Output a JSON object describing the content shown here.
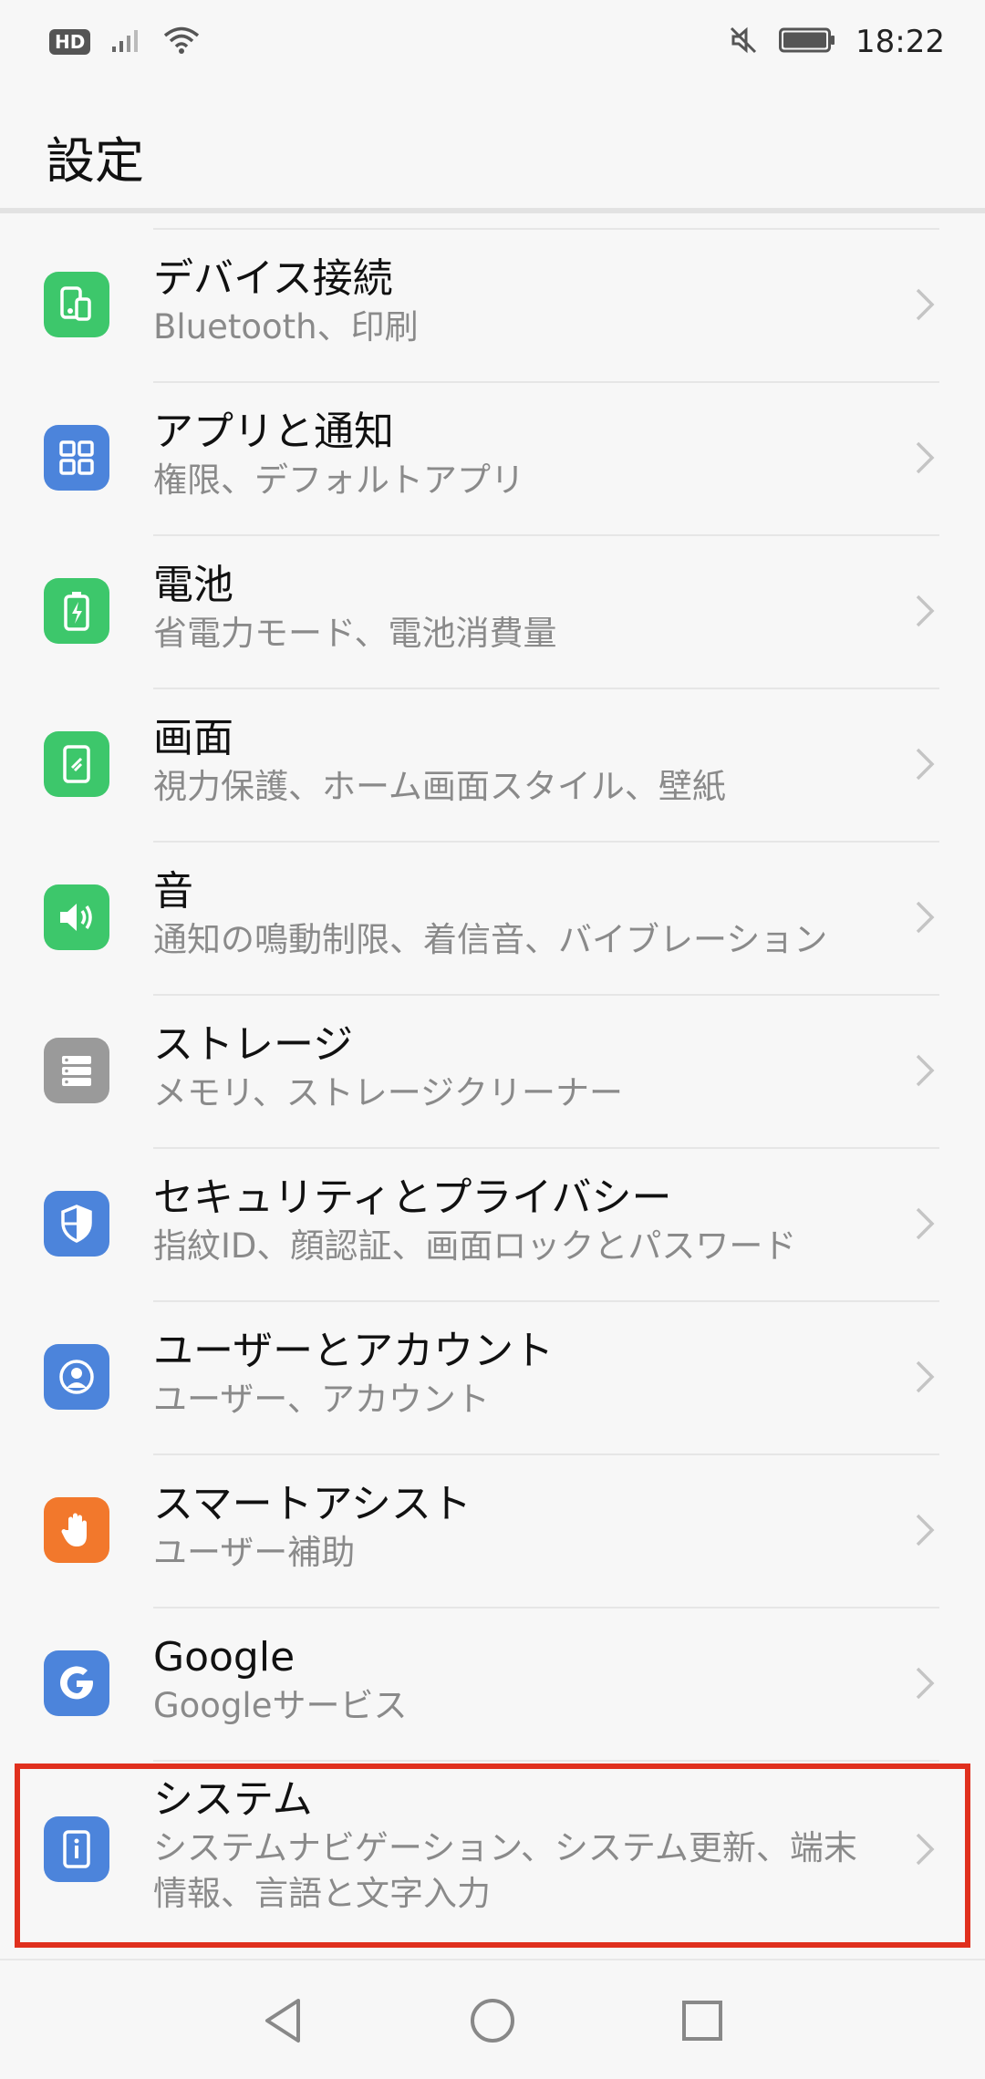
{
  "status_bar": {
    "hd_label": "HD",
    "time": "18:22",
    "icons": [
      "signal-icon",
      "wifi-icon",
      "mute-icon",
      "battery-icon"
    ]
  },
  "header": {
    "title": "設定"
  },
  "items": [
    {
      "title": "デバイス接続",
      "subtitle": "Bluetooth、印刷",
      "icon": "device-connection-icon",
      "color": "#3dc76b"
    },
    {
      "title": "アプリと通知",
      "subtitle": "権限、デフォルトアプリ",
      "icon": "apps-grid-icon",
      "color": "#4c84db"
    },
    {
      "title": "電池",
      "subtitle": "省電力モード、電池消費量",
      "icon": "battery-icon",
      "color": "#3dc76b"
    },
    {
      "title": "画面",
      "subtitle": "視力保護、ホーム画面スタイル、壁紙",
      "icon": "display-icon",
      "color": "#3dc76b"
    },
    {
      "title": "音",
      "subtitle": "通知の鳴動制限、着信音、バイブレーション",
      "icon": "speaker-icon",
      "color": "#3dc76b"
    },
    {
      "title": "ストレージ",
      "subtitle": "メモリ、ストレージクリーナー",
      "icon": "storage-icon",
      "color": "#9a9a9a"
    },
    {
      "title": "セキュリティとプライバシー",
      "subtitle": "指紋ID、顔認証、画面ロックとパスワード",
      "icon": "shield-icon",
      "color": "#4c84db"
    },
    {
      "title": "ユーザーとアカウント",
      "subtitle": "ユーザー、アカウント",
      "icon": "user-icon",
      "color": "#4c84db"
    },
    {
      "title": "スマートアシスト",
      "subtitle": "ユーザー補助",
      "icon": "hand-icon",
      "color": "#f2782c"
    },
    {
      "title": "Google",
      "subtitle": "Googleサービス",
      "icon": "google-icon",
      "color": "#4c84db"
    },
    {
      "title": "システム",
      "subtitle": "システムナビゲーション、システム更新、端末情報、言語と文字入力",
      "icon": "system-info-icon",
      "color": "#4c84db"
    }
  ],
  "nav_bar": {
    "buttons": [
      "back-icon",
      "home-icon",
      "recents-icon"
    ]
  },
  "colors": {
    "highlight": "#e0301e",
    "chevron": "#c4c4c4"
  }
}
